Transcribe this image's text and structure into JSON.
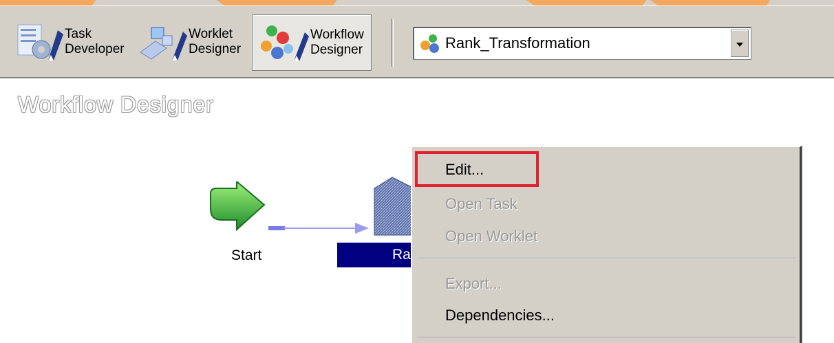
{
  "toolbar": {
    "task_developer": [
      "Task",
      "Developer"
    ],
    "worklet_designer": [
      "Worklet",
      "Designer"
    ],
    "workflow_designer": [
      "Workflow",
      "Designer"
    ],
    "workflow_select": {
      "selected": "Rank_Transformation"
    }
  },
  "canvas": {
    "title": "Workflow Designer",
    "start_label": "Start",
    "session_label": "Ra"
  },
  "context_menu": {
    "items": [
      {
        "label": "Edit...",
        "enabled": true
      },
      {
        "label": "Open Task",
        "enabled": false
      },
      {
        "label": "Open Worklet",
        "enabled": false
      },
      {
        "label": "Export...",
        "enabled": false
      },
      {
        "label": "Dependencies...",
        "enabled": true
      }
    ]
  },
  "colors": {
    "highlight": "#e0202e",
    "selection": "#000080",
    "watermark": "#f4a45a"
  }
}
